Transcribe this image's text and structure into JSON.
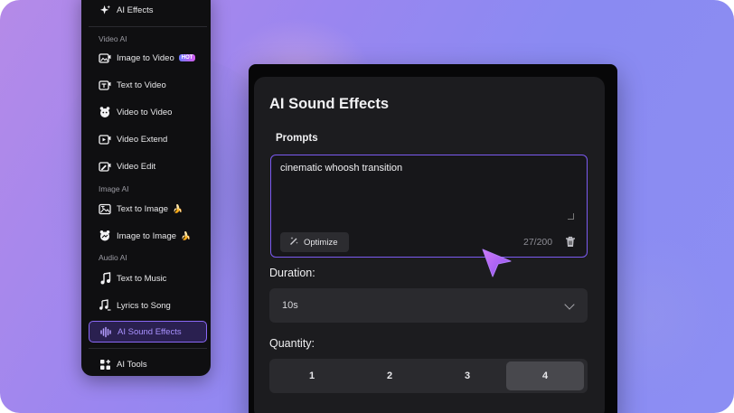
{
  "sidebar": {
    "top_item": {
      "label": "AI Effects",
      "icon": "sparkle-icon"
    },
    "sections": {
      "video": "Video AI",
      "image": "Image AI",
      "audio": "Audio AI"
    },
    "items": [
      {
        "label": "Image to Video",
        "icon": "image-video-icon",
        "badge": "HOT"
      },
      {
        "label": "Text to Video",
        "icon": "text-video-icon"
      },
      {
        "label": "Video to Video",
        "icon": "video-face-icon"
      },
      {
        "label": "Video Extend",
        "icon": "video-extend-icon"
      },
      {
        "label": "Video Edit",
        "icon": "video-edit-icon"
      },
      {
        "label": "Text to Image",
        "icon": "text-image-icon",
        "emoji": "🍌"
      },
      {
        "label": "Image to Image",
        "icon": "image-image-icon",
        "emoji": "🍌"
      },
      {
        "label": "Text to Music",
        "icon": "music-note-icon"
      },
      {
        "label": "Lyrics to Song",
        "icon": "lyrics-song-icon"
      },
      {
        "label": "AI Sound Effects",
        "icon": "sound-wave-icon",
        "active": true
      }
    ],
    "bottom_item": {
      "label": "AI Tools",
      "icon": "grid-tools-icon"
    }
  },
  "panel": {
    "title": "AI Sound Effects",
    "prompts_label": "Prompts",
    "prompt_value": "cinematic whoosh transition",
    "optimize_label": "Optimize",
    "char_count": "27/200",
    "duration_label": "Duration:",
    "duration_value": "10s",
    "quantity_label": "Quantity:",
    "quantity_options": [
      "1",
      "2",
      "3",
      "4"
    ],
    "quantity_selected": "4"
  },
  "colors": {
    "accent": "#8a68f5",
    "panel_bg": "#1c1c1f",
    "sidebar_bg": "#0f0f11",
    "background_gradient_start": "#b58ae8",
    "background_gradient_end": "#8c8ef3"
  }
}
